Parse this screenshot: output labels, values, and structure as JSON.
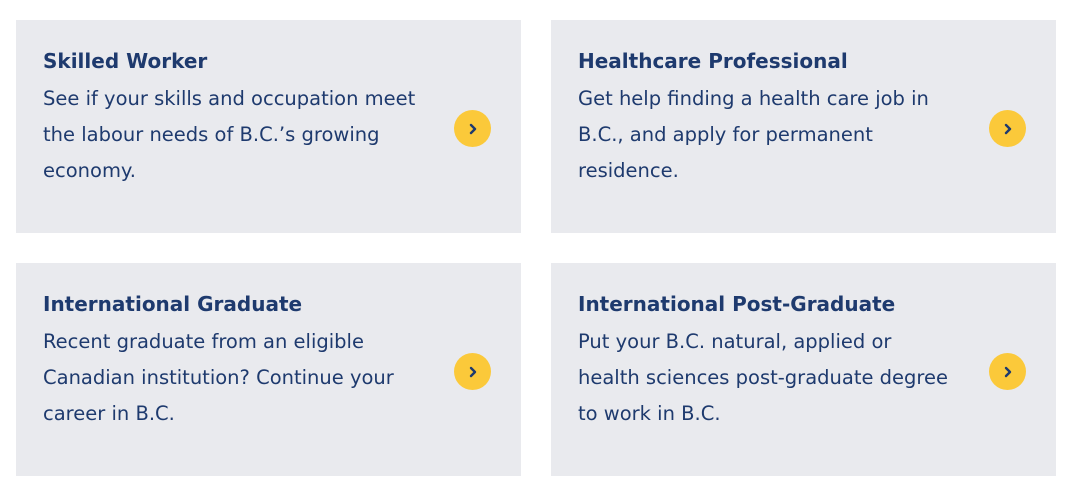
{
  "cards": [
    {
      "title": "Skilled Worker",
      "description": "See if your skills and occupation meet the labour needs of B.C.’s growing economy.",
      "icon": "chevron-right-icon"
    },
    {
      "title": "Healthcare Professional",
      "description": "Get help finding a health care job in B.C., and apply for permanent residence.",
      "icon": "chevron-right-icon"
    },
    {
      "title": "International Graduate",
      "description": "Recent graduate from an eligible Canadian institution? Continue your career in B.C.",
      "icon": "chevron-right-icon"
    },
    {
      "title": "International Post-Graduate",
      "description": "Put your B.C. natural, applied or health sciences post-graduate degree to work in B.C.",
      "icon": "chevron-right-icon"
    }
  ],
  "colors": {
    "card_background": "#e9eaee",
    "text": "#1e3a6e",
    "accent": "#fbc93a"
  }
}
